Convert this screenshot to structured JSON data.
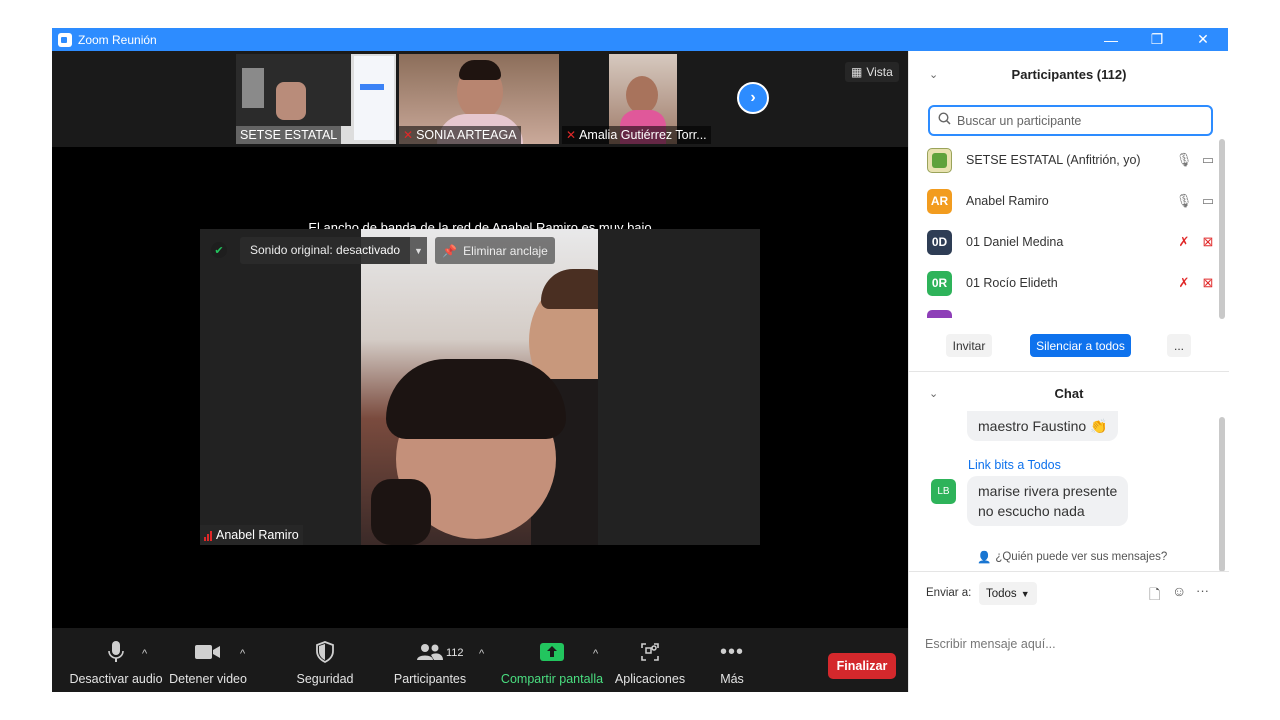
{
  "window": {
    "title": "Zoom Reunión",
    "minimize": "—",
    "restore": "❐",
    "close": "✕"
  },
  "thumbnails": [
    {
      "name": "SETSE ESTATAL",
      "muted": false
    },
    {
      "name": "SONIA ARTEAGA",
      "muted": true
    },
    {
      "name": "Amalia Gutiérrez Torr...",
      "muted": true
    }
  ],
  "view_button": "Vista",
  "bandwidth_message": "El ancho de banda de la red de Anabel Ramiro es muy bajo",
  "main_video": {
    "original_sound": "Sonido original: desactivado",
    "unpin": "Eliminar anclaje",
    "name": "Anabel Ramiro"
  },
  "toolbar": {
    "mute": "Desactivar audio",
    "stop_video": "Detener video",
    "security": "Seguridad",
    "participants": "Participantes",
    "participants_count": "112",
    "share": "Compartir pantalla",
    "apps": "Aplicaciones",
    "more": "Más",
    "end": "Finalizar"
  },
  "participants_panel": {
    "title": "Participantes (112)",
    "search_placeholder": "Buscar un participante",
    "rows": [
      {
        "initials": "",
        "name": "SETSE ESTATAL (Anfitrión, yo)",
        "color": "#e8e2b0",
        "muted": false
      },
      {
        "initials": "AR",
        "name": "Anabel Ramiro",
        "color": "#f29c1f",
        "muted": false
      },
      {
        "initials": "0D",
        "name": "01 Daniel Medina",
        "color": "#2e3d55",
        "muted": true
      },
      {
        "initials": "0R",
        "name": "01 Rocío Elideth",
        "color": "#2eb35a",
        "muted": true
      }
    ],
    "invite": "Invitar",
    "mute_all": "Silenciar a todos",
    "more": "..."
  },
  "chat_panel": {
    "title": "Chat",
    "messages": [
      {
        "sender": "",
        "text": "maestro Faustino 👏"
      },
      {
        "sender": "Link bits a Todos",
        "avatar": "LB",
        "line1": "marise rivera presente",
        "line2": "no escucho nada"
      }
    ],
    "privacy": "¿Quién puede ver sus mensajes?",
    "send_to_label": "Enviar a:",
    "send_to_value": "Todos",
    "input_placeholder": "Escribir mensaje aquí..."
  }
}
